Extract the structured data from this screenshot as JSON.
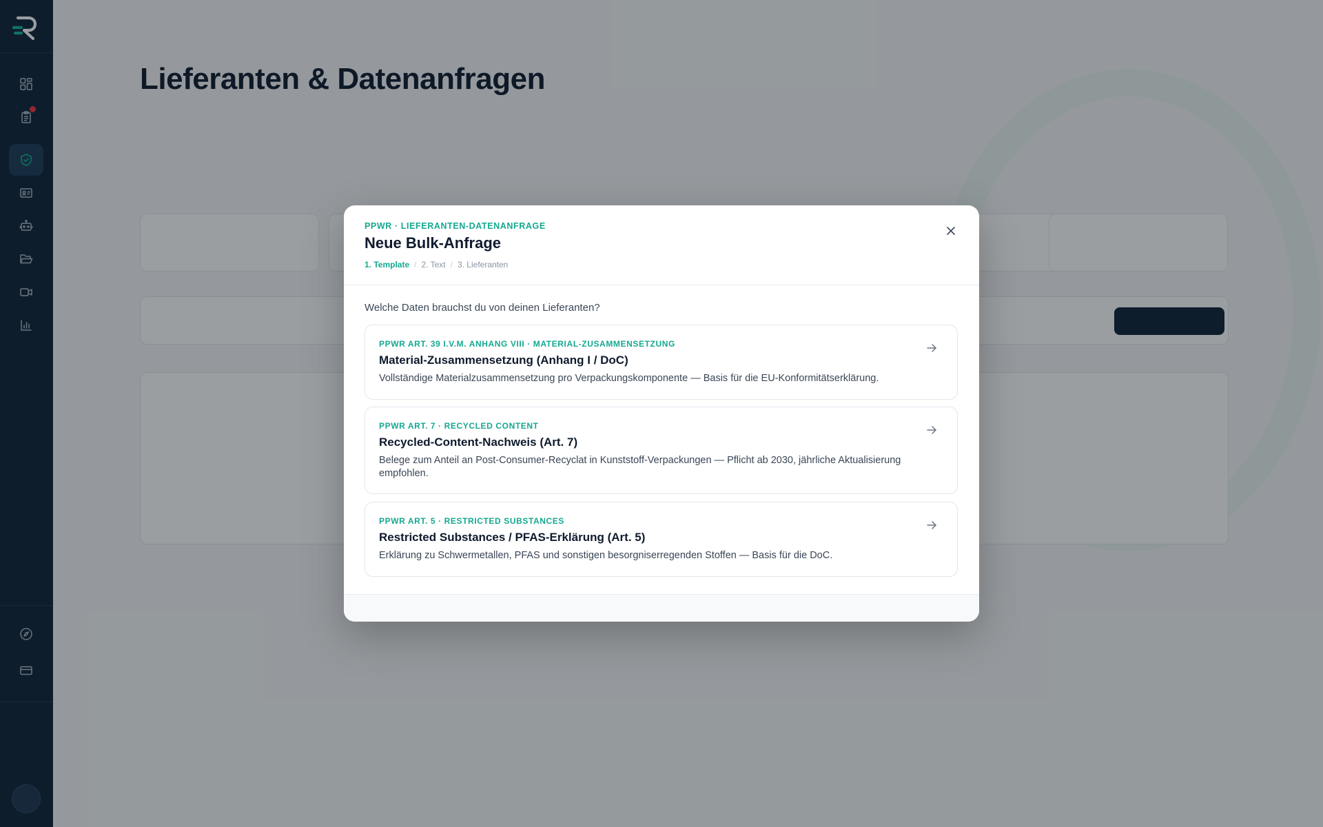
{
  "sidebar": {
    "items": [
      {
        "icon": "dashboard-icon"
      },
      {
        "icon": "clipboard-list-icon",
        "has_badge": true
      },
      {
        "icon": "shield-check-icon",
        "active": true
      },
      {
        "icon": "id-card-icon"
      },
      {
        "icon": "robot-icon"
      },
      {
        "icon": "folder-open-icon"
      },
      {
        "icon": "video-camera-icon"
      },
      {
        "icon": "bar-chart-icon"
      }
    ],
    "bottom_items": [
      {
        "icon": "compass-icon"
      },
      {
        "icon": "credit-card-icon"
      }
    ]
  },
  "background": {
    "title": "Lieferanten & Datenanfragen"
  },
  "modal": {
    "eyebrow": "PPWR · LIEFERANTEN-DATENANFRAGE",
    "title": "Neue Bulk-Anfrage",
    "steps": [
      "1. Template",
      "2. Text",
      "3. Lieferanten"
    ],
    "active_step": 0,
    "question": "Welche Daten brauchst du von deinen Lieferanten?",
    "templates": [
      {
        "eyebrow": "PPWR ART. 39 I.V.M. ANHANG VIII · MATERIAL-ZUSAMMENSETZUNG",
        "title": "Material-Zusammensetzung (Anhang I / DoC)",
        "desc": "Vollständige Materialzusammensetzung pro Verpackungskomponente — Basis für die EU-Konformitätserklärung."
      },
      {
        "eyebrow": "PPWR ART. 7 · RECYCLED CONTENT",
        "title": "Recycled-Content-Nachweis (Art. 7)",
        "desc": "Belege zum Anteil an Post-Consumer-Recyclat in Kunststoff-Verpackungen — Pflicht ab 2030, jährliche Aktualisierung empfohlen."
      },
      {
        "eyebrow": "PPWR ART. 5 · RESTRICTED SUBSTANCES",
        "title": "Restricted Substances / PFAS-Erklärung (Art. 5)",
        "desc": "Erklärung zu Schwermetallen, PFAS und sonstigen besorgniserregenden Stoffen — Basis für die DoC."
      }
    ]
  },
  "colors": {
    "sidebar_bg": "#0f2236",
    "accent": "#14a890",
    "badge": "#ef3340"
  }
}
